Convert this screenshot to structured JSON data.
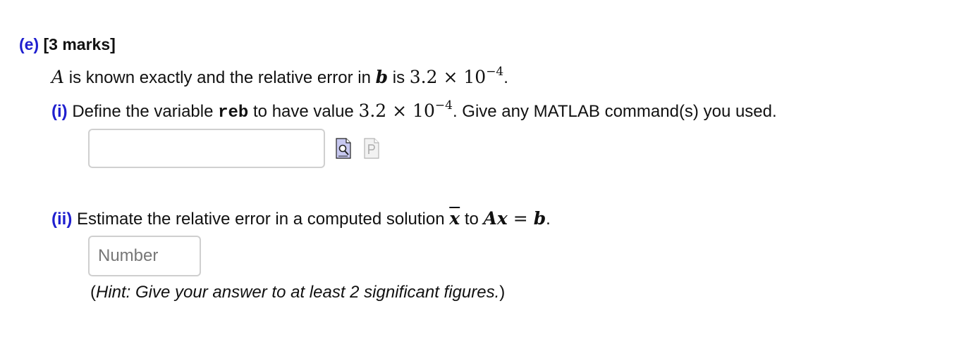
{
  "section": {
    "label": "(e)",
    "marks": "[3 marks]"
  },
  "statement": {
    "var_A": "A",
    "text1": " is known exactly and the relative error in ",
    "var_b": "b",
    "text2": " is ",
    "value_mantissa": "3.2 × 10",
    "value_exponent": "−4",
    "end": "."
  },
  "part_i": {
    "label": "(i)",
    "text1": " Define the variable ",
    "varname": "reb",
    "text2": " to have value ",
    "value_mantissa": "3.2 × 10",
    "value_exponent": "−4",
    "text3": ". Give any MATLAB command(s) you used.",
    "input_value": "",
    "preview_icon": "preview-icon",
    "paste_icon": "paste-icon"
  },
  "part_ii": {
    "label": "(ii)",
    "text1": " Estimate the relative error in a computed solution ",
    "var_xbar": "x",
    "text2": " to ",
    "eq_lhs": "Ax",
    "eq_sign": " = ",
    "eq_rhs": "b",
    "end": ".",
    "input_placeholder": "Number",
    "input_value": ""
  },
  "hint": {
    "open": "(",
    "text": "Hint: Give your answer to at least 2 significant figures.",
    "close": ")"
  }
}
